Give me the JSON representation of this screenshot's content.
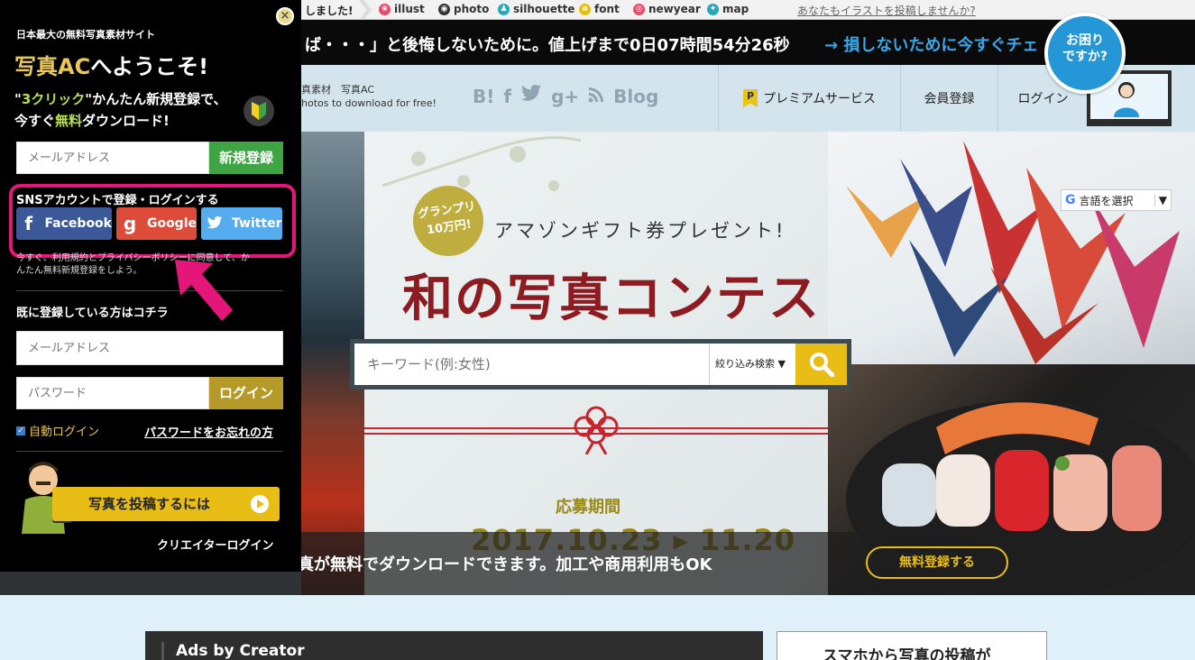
{
  "topnav": {
    "announce": "しました!",
    "links": [
      {
        "label": "illust",
        "icon": "illust-icon",
        "color": "#e84a6a"
      },
      {
        "label": "photo",
        "icon": "camera-icon",
        "color": "#333333"
      },
      {
        "label": "silhouette",
        "icon": "silhouette-icon",
        "color": "#2aa6b8"
      },
      {
        "label": "font",
        "icon": "font-icon",
        "color": "#e8bd16"
      },
      {
        "label": "newyear",
        "icon": "newyear-icon",
        "color": "#e84a6a"
      },
      {
        "label": "map",
        "icon": "map-icon",
        "color": "#2aa6b8"
      }
    ],
    "cta": "あなたもイラストを投稿しませんか?"
  },
  "countdown": {
    "text": "ば・・・」と後悔しないために。値上げまで0日07時間54分26秒",
    "link": "→ 損しないために今すぐチェ"
  },
  "header": {
    "logo_line1": "真素材　写真AC",
    "logo_line2": "hotos to download for free!",
    "social": [
      "B!",
      "f",
      "twitter-icon",
      "g+",
      "rss-icon",
      "Blog"
    ],
    "blog_label": "Blog",
    "nav": {
      "premium": "プレミアムサービス",
      "premium_badge": "P",
      "register": "会員登録",
      "login": "ログイン"
    },
    "help": {
      "line1": "お困り",
      "line2": "ですか?"
    }
  },
  "translate": {
    "label": "言語を選択",
    "caret": "▼",
    "g": "G"
  },
  "contest": {
    "grand_line1": "グランプリ",
    "grand_line2": "10万円!",
    "prize": "アマゾンギフト券プレゼント!",
    "title": "和の写真コンテスト",
    "period_label": "応募期間",
    "dates": "2017.10.23 ▸ 11.20"
  },
  "search": {
    "placeholder": "キーワード(例:女性)",
    "filter": "絞り込み検索 ▼"
  },
  "strip": {
    "text": "高品質な写真が無料でダウンロードできます。加工や商用利用もOK",
    "register": "無料登録する"
  },
  "lower": {
    "ads_title": "Ads by Creator",
    "mobile_title": "スマホから写真の投稿が"
  },
  "panel": {
    "close": "×",
    "tagline": "日本最大の無料写真素材サイト",
    "welcome_accent": "写真AC",
    "welcome_rest": "へようこそ!",
    "promo_q1": "\"",
    "promo_green1": "3クリック",
    "promo_rest1": "\"かんたん新規登録で、",
    "promo_pre2": "今すぐ",
    "promo_green2": "無料",
    "promo_rest2": "ダウンロード!",
    "email_placeholder": "メールアドレス",
    "signup_button": "新規登録",
    "sns_label": "SNSアカウントで登録・ログインする",
    "facebook": "Facebook",
    "google": "Google",
    "twitter": "Twitter",
    "terms_line1": "今すぐ、利用規約とプライバシーポリシーに同意して、か",
    "terms_line2": "んたん無料新規登録をしよう。",
    "already": "既に登録している方はコチラ",
    "login_email_placeholder": "メールアドレス",
    "password_placeholder": "パスワード",
    "login_button": "ログイン",
    "auto_login": "自動ログイン",
    "forgot": "パスワードをお忘れの方",
    "post_button": "写真を投稿するには",
    "creator_login": "クリエイターログイン"
  },
  "colors": {
    "accent_yellow": "#e8bd16",
    "highlight_pink": "#e5167a",
    "facebook": "#3b5998",
    "google": "#dd4b39",
    "twitter": "#55acee",
    "signup_green": "#3fa443"
  }
}
